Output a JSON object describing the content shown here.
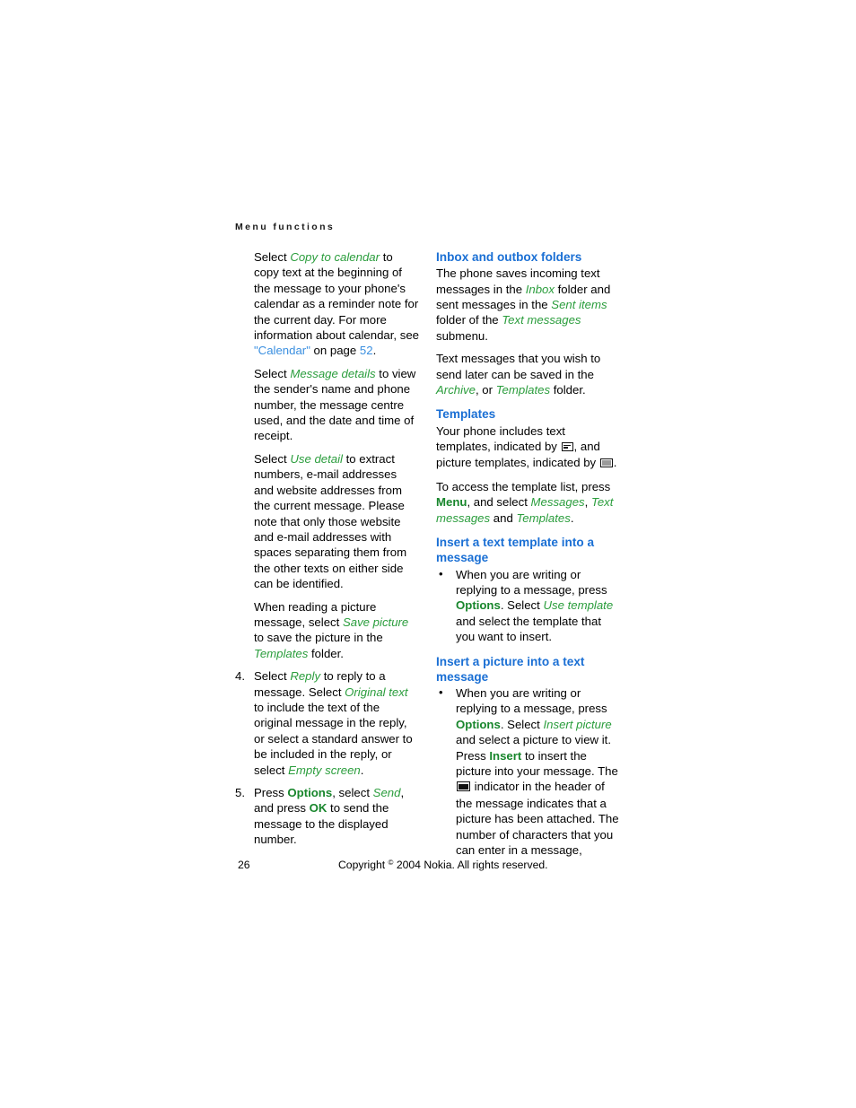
{
  "document": {
    "running_header": "Menu functions",
    "page_number": "26",
    "copyright_prefix": "Copyright ",
    "copyright_symbol": "©",
    "copyright_suffix": " 2004 Nokia. All rights reserved."
  },
  "colors": {
    "heading_blue": "#1a6fd4",
    "link_blue": "#3a8fe0",
    "ui_term_green": "#2a9d3c",
    "hard_key_green": "#18862c",
    "body_black": "#000000"
  },
  "left_column": {
    "paragraphs": [
      {
        "id": "copy-to-calendar",
        "type": "paragraph",
        "runs": [
          {
            "text": "Select ",
            "style": "plain"
          },
          {
            "text": "Copy to calendar",
            "style": "ui-term"
          },
          {
            "text": " to copy text at the beginning of the message to your phone's calendar as a reminder note for the current day. For more information about calendar, see ",
            "style": "plain"
          },
          {
            "text": "\"Calendar\"",
            "style": "xref"
          },
          {
            "text": " on page ",
            "style": "plain"
          },
          {
            "text": "52",
            "style": "xref"
          },
          {
            "text": ".",
            "style": "plain"
          }
        ]
      },
      {
        "id": "message-details",
        "type": "paragraph",
        "runs": [
          {
            "text": "Select ",
            "style": "plain"
          },
          {
            "text": "Message details",
            "style": "ui-term"
          },
          {
            "text": " to view the sender's name and phone number, the message centre used, and the date and time of receipt.",
            "style": "plain"
          }
        ]
      },
      {
        "id": "use-detail",
        "type": "paragraph",
        "runs": [
          {
            "text": "Select ",
            "style": "plain"
          },
          {
            "text": "Use detail",
            "style": "ui-term"
          },
          {
            "text": " to extract numbers, e-mail addresses and website addresses from the current message. Please note that only those website and e-mail addresses with spaces separating them from the other texts on either side can be identified.",
            "style": "plain"
          }
        ]
      },
      {
        "id": "save-picture",
        "type": "paragraph",
        "runs": [
          {
            "text": "When reading a picture message, select ",
            "style": "plain"
          },
          {
            "text": "Save picture",
            "style": "ui-term"
          },
          {
            "text": " to save the picture in the ",
            "style": "plain"
          },
          {
            "text": "Templates",
            "style": "ui-term"
          },
          {
            "text": " folder.",
            "style": "plain"
          }
        ]
      },
      {
        "id": "step-4",
        "type": "numbered",
        "number": "4.",
        "runs": [
          {
            "text": "Select ",
            "style": "plain"
          },
          {
            "text": "Reply",
            "style": "ui-term"
          },
          {
            "text": " to reply to a message. Select ",
            "style": "plain"
          },
          {
            "text": "Original text",
            "style": "ui-term"
          },
          {
            "text": " to include the text of the original message in the reply, or select a standard answer to be included in the reply, or select ",
            "style": "plain"
          },
          {
            "text": "Empty screen",
            "style": "ui-term"
          },
          {
            "text": ".",
            "style": "plain"
          }
        ]
      },
      {
        "id": "step-5",
        "type": "numbered",
        "number": "5.",
        "runs": [
          {
            "text": "Press ",
            "style": "plain"
          },
          {
            "text": "Options",
            "style": "hard-key"
          },
          {
            "text": ", select ",
            "style": "plain"
          },
          {
            "text": "Send",
            "style": "ui-term"
          },
          {
            "text": ", and press ",
            "style": "plain"
          },
          {
            "text": "OK",
            "style": "hard-key"
          },
          {
            "text": " to send the message to the displayed number.",
            "style": "plain"
          }
        ]
      }
    ]
  },
  "right_column": {
    "sections": [
      {
        "id": "inbox-and-outbox-folders",
        "heading": "Inbox and outbox folders",
        "blocks": [
          {
            "id": "inbox-p1",
            "type": "paragraph",
            "runs": [
              {
                "text": "The phone saves incoming text messages in the ",
                "style": "plain"
              },
              {
                "text": "Inbox",
                "style": "ui-term"
              },
              {
                "text": " folder and sent messages in the ",
                "style": "plain"
              },
              {
                "text": "Sent items",
                "style": "ui-term"
              },
              {
                "text": " folder of the ",
                "style": "plain"
              },
              {
                "text": "Text messages",
                "style": "ui-term"
              },
              {
                "text": " submenu.",
                "style": "plain"
              }
            ]
          },
          {
            "id": "inbox-p2",
            "type": "paragraph",
            "runs": [
              {
                "text": "Text messages that you wish to send later can be saved in the ",
                "style": "plain"
              },
              {
                "text": "Archive",
                "style": "ui-term"
              },
              {
                "text": ", or ",
                "style": "plain"
              },
              {
                "text": "Templates",
                "style": "ui-term"
              },
              {
                "text": " folder.",
                "style": "plain"
              }
            ]
          }
        ]
      },
      {
        "id": "templates",
        "heading": "Templates",
        "blocks": [
          {
            "id": "templates-p1",
            "type": "paragraph",
            "runs": [
              {
                "text": "Your phone includes text templates, indicated by ",
                "style": "plain"
              },
              {
                "text": "",
                "style": "icon",
                "icon": "text-template-icon"
              },
              {
                "text": ", and picture templates, indicated by ",
                "style": "plain"
              },
              {
                "text": "",
                "style": "icon",
                "icon": "picture-template-icon"
              },
              {
                "text": ".",
                "style": "plain"
              }
            ]
          },
          {
            "id": "templates-p2",
            "type": "paragraph",
            "runs": [
              {
                "text": "To access the template list, press ",
                "style": "plain"
              },
              {
                "text": "Menu",
                "style": "hard-key"
              },
              {
                "text": ", and select ",
                "style": "plain"
              },
              {
                "text": "Messages",
                "style": "ui-term"
              },
              {
                "text": ", ",
                "style": "plain"
              },
              {
                "text": "Text messages",
                "style": "ui-term"
              },
              {
                "text": " and ",
                "style": "plain"
              },
              {
                "text": "Templates",
                "style": "ui-term"
              },
              {
                "text": ".",
                "style": "plain"
              }
            ]
          }
        ]
      },
      {
        "id": "insert-text-template",
        "heading": "Insert a text template into a message",
        "blocks": [
          {
            "id": "insert-text-bullet",
            "type": "bullet",
            "bullet_glyph": "•",
            "runs": [
              {
                "text": "When you are writing or replying to a message, press ",
                "style": "plain"
              },
              {
                "text": "Options",
                "style": "hard-key"
              },
              {
                "text": ". Select ",
                "style": "plain"
              },
              {
                "text": "Use template",
                "style": "ui-term"
              },
              {
                "text": " and select the template that you want to insert.",
                "style": "plain"
              }
            ]
          }
        ]
      },
      {
        "id": "insert-picture",
        "heading": "Insert a picture into a text message",
        "blocks": [
          {
            "id": "insert-picture-bullet",
            "type": "bullet",
            "bullet_glyph": "•",
            "runs": [
              {
                "text": "When you are writing or replying to a message, press ",
                "style": "plain"
              },
              {
                "text": "Options",
                "style": "hard-key"
              },
              {
                "text": ". Select ",
                "style": "plain"
              },
              {
                "text": "Insert picture",
                "style": "ui-term"
              },
              {
                "text": " and select a picture to view it. Press ",
                "style": "plain"
              },
              {
                "text": "Insert",
                "style": "hard-key"
              },
              {
                "text": " to insert the picture into your message. The ",
                "style": "plain"
              },
              {
                "text": "",
                "style": "icon",
                "icon": "picture-attached-indicator-icon"
              },
              {
                "text": " indicator in the header of the message indicates that a picture has been attached. The number of characters that you can enter in a message,",
                "style": "plain"
              }
            ]
          }
        ]
      }
    ]
  }
}
